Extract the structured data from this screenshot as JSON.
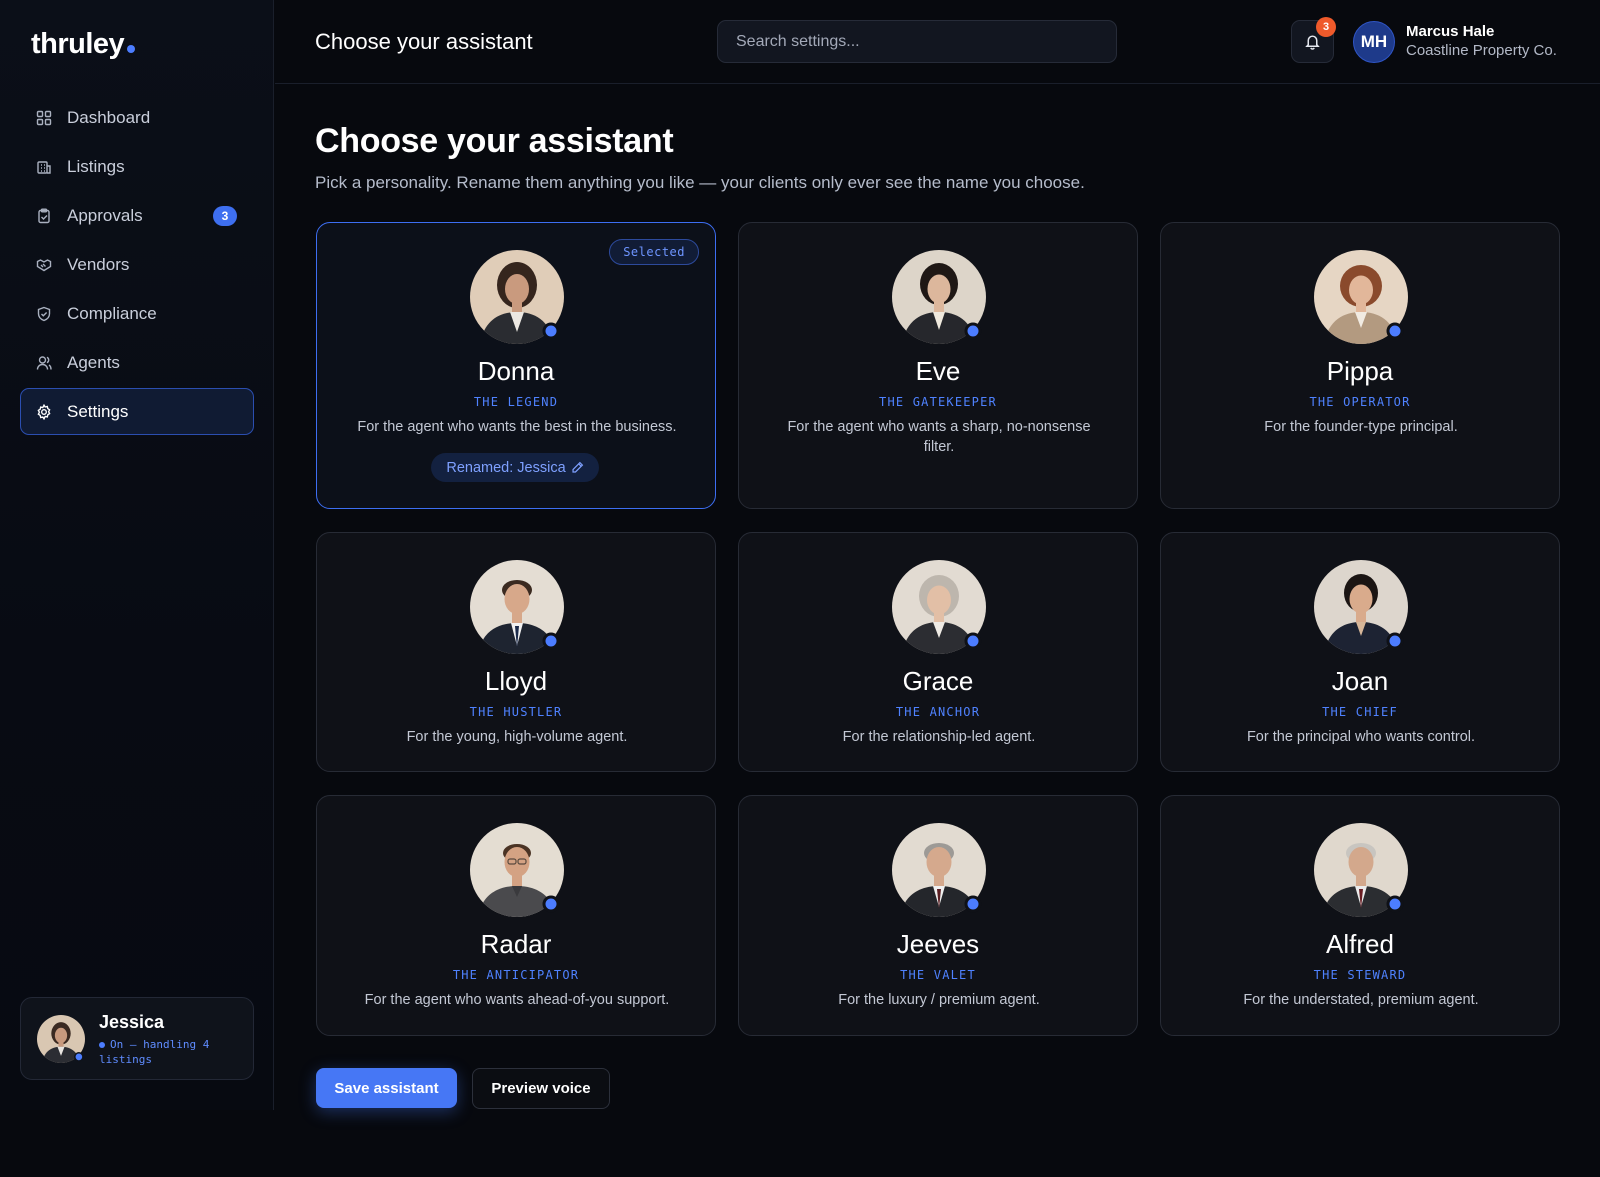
{
  "brand": {
    "name": "thruley"
  },
  "sidebar": {
    "items": [
      {
        "label": "Dashboard",
        "icon": "grid-icon"
      },
      {
        "label": "Listings",
        "icon": "building-icon"
      },
      {
        "label": "Approvals",
        "icon": "clipboard-check-icon",
        "badge": "3"
      },
      {
        "label": "Vendors",
        "icon": "handshake-icon"
      },
      {
        "label": "Compliance",
        "icon": "shield-check-icon"
      },
      {
        "label": "Agents",
        "icon": "users-icon"
      },
      {
        "label": "Settings",
        "icon": "gear-icon",
        "active": true
      }
    ],
    "assistant": {
      "name": "Jessica",
      "status": "On — handling 4 listings"
    }
  },
  "header": {
    "title": "Choose your assistant",
    "search_placeholder": "Search settings...",
    "notifications_count": "3",
    "user": {
      "initials": "MH",
      "name": "Marcus Hale",
      "org": "Coastline Property Co."
    }
  },
  "main": {
    "title": "Choose your assistant",
    "subtitle": "Pick a personality. Rename them anything you like — your clients only ever see the name you choose.",
    "selected_label": "Selected",
    "renamed_label": "Renamed: Jessica",
    "assistants": [
      {
        "name": "Donna",
        "role": "THE LEGEND",
        "desc": "For the agent who wants the best in the business.",
        "selected": true
      },
      {
        "name": "Eve",
        "role": "THE GATEKEEPER",
        "desc": "For the agent who wants a sharp, no-nonsense filter."
      },
      {
        "name": "Pippa",
        "role": "THE OPERATOR",
        "desc": "For the founder-type principal."
      },
      {
        "name": "Lloyd",
        "role": "THE HUSTLER",
        "desc": "For the young, high-volume agent."
      },
      {
        "name": "Grace",
        "role": "THE ANCHOR",
        "desc": "For the relationship-led agent."
      },
      {
        "name": "Joan",
        "role": "THE CHIEF",
        "desc": "For the principal who wants control."
      },
      {
        "name": "Radar",
        "role": "THE ANTICIPATOR",
        "desc": "For the agent who wants ahead-of-you support."
      },
      {
        "name": "Jeeves",
        "role": "THE VALET",
        "desc": "For the luxury / premium agent."
      },
      {
        "name": "Alfred",
        "role": "THE STEWARD",
        "desc": "For the understated, premium agent."
      }
    ],
    "save_label": "Save assistant",
    "preview_label": "Preview voice"
  },
  "colors": {
    "accent": "#4677f5",
    "background": "#07090e",
    "card": "#0f1117",
    "notification": "#ef5a2b"
  }
}
